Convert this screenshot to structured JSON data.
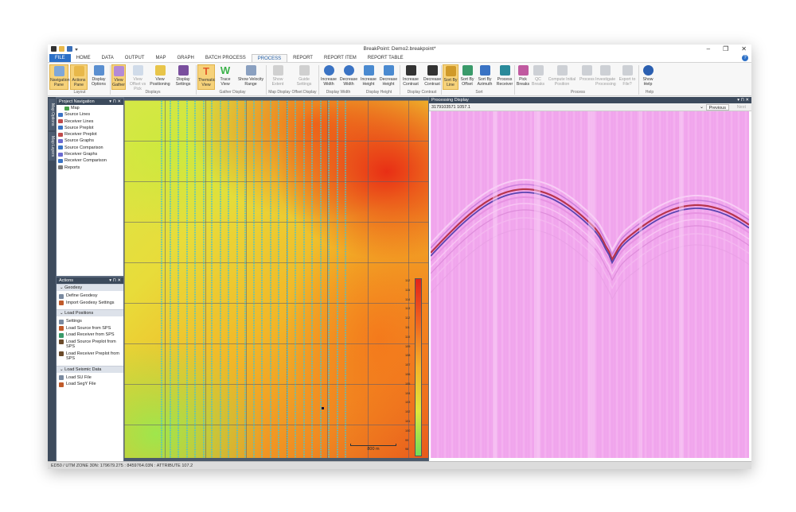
{
  "app": {
    "title": "BreakPoint: Demo2.breakpoint*",
    "window_controls": [
      "–",
      "❐",
      "✕"
    ]
  },
  "menu": {
    "tabs": [
      "FILE",
      "HOME",
      "DATA",
      "OUTPUT",
      "MAP",
      "GRAPH",
      "BATCH PROCESS",
      "PROCESS",
      "REPORT",
      "REPORT ITEM",
      "REPORT TABLE"
    ],
    "active": "PROCESS"
  },
  "ribbon": {
    "buttons": [
      {
        "label": "Navigation Pane",
        "icon": "navigation-pane-icon",
        "state": "highlighted"
      },
      {
        "label": "Actions Pane",
        "icon": "actions-pane-icon",
        "state": "highlighted"
      },
      {
        "label": "Display Options",
        "icon": "display-options-icon",
        "state": "normal"
      },
      {
        "label": "View Gather",
        "icon": "view-gather-icon",
        "state": "highlighted"
      },
      {
        "label": "View Offset vs Pick",
        "icon": "offset-pick-icon",
        "state": "disabled"
      },
      {
        "label": "View Positioning",
        "icon": "positioning-icon",
        "state": "normal"
      },
      {
        "label": "Display Settings",
        "icon": "display-settings-icon",
        "state": "normal"
      },
      {
        "label": "Thematic View",
        "icon": "thematic-view-icon",
        "state": "highlighted"
      },
      {
        "label": "Trace View",
        "icon": "trace-view-icon",
        "state": "normal"
      },
      {
        "label": "Show Velocity Range",
        "icon": "velocity-range-icon",
        "state": "normal"
      },
      {
        "label": "Show Extent",
        "icon": "show-extent-icon",
        "state": "disabled"
      },
      {
        "label": "Guide Settings",
        "icon": "guide-settings-icon",
        "state": "disabled"
      },
      {
        "label": "Increase Width",
        "icon": "zoom-in-icon",
        "state": "normal"
      },
      {
        "label": "Decrease Width",
        "icon": "zoom-out-icon",
        "state": "normal"
      },
      {
        "label": "Increase Height",
        "icon": "increase-height-icon",
        "state": "normal"
      },
      {
        "label": "Decrease Height",
        "icon": "decrease-height-icon",
        "state": "normal"
      },
      {
        "label": "Increase Contrast",
        "icon": "increase-contrast-icon",
        "state": "normal"
      },
      {
        "label": "Decrease Contrast",
        "icon": "decrease-contrast-icon",
        "state": "normal"
      },
      {
        "label": "Sort By Line",
        "icon": "sort-line-icon",
        "state": "highlighted"
      },
      {
        "label": "Sort By Offset",
        "icon": "sort-offset-icon",
        "state": "normal"
      },
      {
        "label": "Sort By Azimuth",
        "icon": "sort-azimuth-icon",
        "state": "normal"
      },
      {
        "label": "Process Receiver",
        "icon": "process-receiver-icon",
        "state": "normal"
      },
      {
        "label": "Pick Breaks",
        "icon": "pick-breaks-icon",
        "state": "normal"
      },
      {
        "label": "QC Breaks",
        "icon": "qc-breaks-icon",
        "state": "disabled"
      },
      {
        "label": "Compute Initial Position",
        "icon": "compute-position-icon",
        "state": "disabled"
      },
      {
        "label": "Process",
        "icon": "process-icon",
        "state": "disabled"
      },
      {
        "label": "Investigate Processing",
        "icon": "investigate-icon",
        "state": "disabled"
      },
      {
        "label": "Export to File?",
        "icon": "export-icon",
        "state": "disabled"
      },
      {
        "label": "Show Help",
        "icon": "help-icon",
        "state": "normal"
      }
    ],
    "groups": [
      "Layout",
      "Displays",
      "Gather Display",
      "Map Display",
      "Offset Display",
      "Display Width",
      "Display Height",
      "Display Contrast",
      "Sort",
      "Process",
      "Help"
    ]
  },
  "side_tabs": [
    "Map Options",
    "Map Layers"
  ],
  "project_navigation": {
    "title": "Project Navigation",
    "controls": "▾ ⊓ ✕",
    "items": [
      "Map",
      "Source Lines",
      "Receiver Lines",
      "Source Preplot",
      "Receiver Preplot",
      "Source Graphs",
      "Source Comparison",
      "Receiver Graphs",
      "Receiver Comparison",
      "Reports"
    ]
  },
  "actions": {
    "title": "Actions",
    "controls": "▾ ⊓ ✕",
    "sections": [
      {
        "title": "Geodesy",
        "items": [
          "Define Geodesy",
          "Import Geodesy Settings"
        ]
      },
      {
        "title": "Load Positions",
        "items": [
          "Settings",
          "Load Source from SPS",
          "Load Receiver from SPS",
          "Load Source Preplot from SPS",
          "Load Receiver Preplot from SPS"
        ]
      },
      {
        "title": "Load Seismic Data",
        "items": [
          "Load SU File",
          "Load SegY File"
        ]
      }
    ]
  },
  "map": {
    "legend_ticks": [
      "112",
      "115",
      "114",
      "113",
      "112",
      "111",
      "110",
      "109",
      "108",
      "107",
      "106",
      "105",
      "104",
      "103",
      "102",
      "101",
      "100",
      "99",
      "98"
    ],
    "scale_label": "800 m",
    "colors": {
      "high": "#e2231a",
      "mid": "#f5b228",
      "low": "#6fdc5a",
      "receiver_points": "#4fc3c8"
    }
  },
  "processing_display": {
    "title": "Processing Display",
    "controls": "▾ ⊓ ✕",
    "receiver_id": "3179103571 1057.1",
    "previous_label": "Previous",
    "next_label": "Next"
  },
  "status_bar": {
    "text": "ED50 / UTM ZONE 30N: 179679.275 : 8459764.03N : ATTRIBUTE 107.2"
  }
}
